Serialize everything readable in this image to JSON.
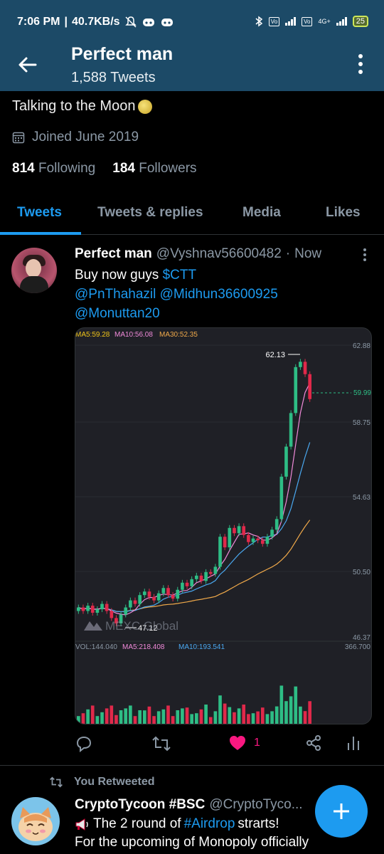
{
  "status_bar": {
    "time": "7:06 PM",
    "speed": "40.7KB/s",
    "network": "4G+",
    "battery": "25"
  },
  "header": {
    "title": "Perfect man",
    "subtitle": "1,588 Tweets"
  },
  "profile": {
    "bio": "Talking to the Moon",
    "joined": "Joined June 2019",
    "following_count": "814",
    "following_label": "Following",
    "followers_count": "184",
    "followers_label": "Followers"
  },
  "tabs": [
    {
      "label": "Tweets",
      "active": true
    },
    {
      "label": "Tweets & replies",
      "active": false
    },
    {
      "label": "Media",
      "active": false
    },
    {
      "label": "Likes",
      "active": false
    }
  ],
  "tweet1": {
    "name": "Perfect man",
    "handle": "@Vyshnav56600482",
    "dot": "·",
    "time": "Now",
    "text_prefix": "Buy now guys ",
    "cashtag": "$CTT",
    "mentions_line1": "@PnThahazil @Midhun36600925",
    "mentions_line2": "@Monuttan20",
    "like_count": "1"
  },
  "chart_image": {
    "ma_labels": [
      "MA5:59.28",
      "MA10:56.08",
      "MA30:52.35"
    ],
    "price_ticks": [
      "62.88",
      "58.75",
      "54.63",
      "50.50",
      "46.37"
    ],
    "high_label": "62.13",
    "low_label": "47.12",
    "current_price": "59.99",
    "watermark": "MEXC Global",
    "vol_labels": [
      "VOL:144.040",
      "MA5:218.408",
      "MA10:193.541"
    ],
    "vol_max": "366.700"
  },
  "tweet2": {
    "retweet_label": "You Retweeted",
    "name": "CryptoTycoon #BSC",
    "handle": "@CryptoTyco...",
    "line1_prefix": "The 2 round of ",
    "hashtag": "#Airdrop",
    "line1_suffix": " strarts!",
    "line2": "For the upcoming of Monopoly officially"
  },
  "colors": {
    "appbar": "#1c4a67",
    "accent": "#1d9bf0",
    "like": "#f91880",
    "candle_up": "#2ebd85",
    "candle_down": "#e0294a"
  }
}
